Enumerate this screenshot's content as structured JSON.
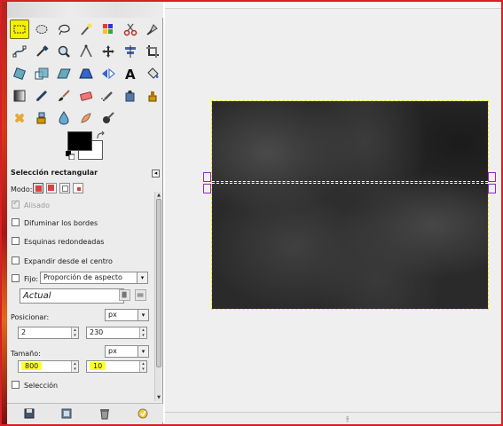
{
  "window": {
    "frame_color": "#d81f26"
  },
  "toolbox": {
    "tools": [
      {
        "name": "rect-select-icon",
        "active": true
      },
      {
        "name": "ellipse-select-icon"
      },
      {
        "name": "lasso-icon"
      },
      {
        "name": "fuzzy-select-icon"
      },
      {
        "name": "select-by-color-icon"
      },
      {
        "name": "scissors-icon"
      },
      {
        "name": "foreground-select-icon"
      },
      {
        "name": "paths-icon"
      },
      {
        "name": "color-picker-icon"
      },
      {
        "name": "zoom-icon"
      },
      {
        "name": "measure-icon"
      },
      {
        "name": "move-icon"
      },
      {
        "name": "align-icon"
      },
      {
        "name": "crop-icon"
      },
      {
        "name": "rotate-icon"
      },
      {
        "name": "scale-icon"
      },
      {
        "name": "shear-icon"
      },
      {
        "name": "perspective-icon"
      },
      {
        "name": "flip-icon"
      },
      {
        "name": "text-icon"
      },
      {
        "name": "bucket-fill-icon"
      },
      {
        "name": "blend-icon"
      },
      {
        "name": "pencil-icon"
      },
      {
        "name": "paintbrush-icon"
      },
      {
        "name": "eraser-icon"
      },
      {
        "name": "airbrush-icon"
      },
      {
        "name": "ink-icon"
      },
      {
        "name": "clone-icon"
      },
      {
        "name": "heal-icon"
      },
      {
        "name": "perspective-clone-icon"
      },
      {
        "name": "blur-icon"
      },
      {
        "name": "smudge-icon"
      },
      {
        "name": "dodge-burn-icon"
      }
    ],
    "colors": {
      "foreground": "#000000",
      "background": "#ffffff"
    }
  },
  "options": {
    "title": "Selección rectangular",
    "mode_label": "Modo:",
    "antialias_label": "Alisado",
    "feather_label": "Difuminar los bordes",
    "rounded_label": "Esquinas redondeadas",
    "expand_label": "Expandir desde el centro",
    "fixed_label": "Fijo:",
    "fixed_value": "Proporción de aspecto",
    "actual_value": "Actual",
    "position_label": "Posicionar:",
    "position_unit": "px",
    "position_x": "2",
    "position_y": "230",
    "size_label": "Tamaño:",
    "size_unit": "px",
    "size_w": "800",
    "size_h": "10",
    "highlight_label": "Selección"
  },
  "canvas": {
    "background": "#efefef",
    "image_color": "#2a2a2a",
    "grip": "⦙⦙⦙"
  }
}
